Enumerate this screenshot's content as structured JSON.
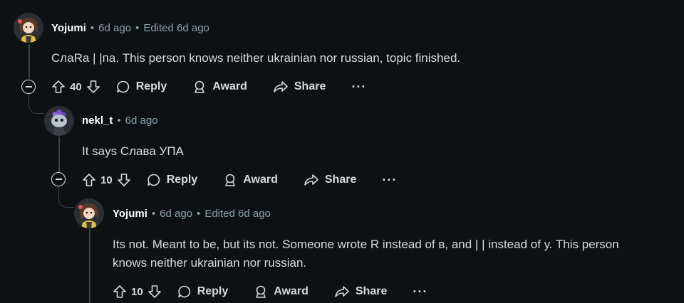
{
  "comments": [
    {
      "username": "Yojumi",
      "time": "6d ago",
      "edited": "Edited 6d ago",
      "body": "СлаRa | |па. This person knows neither ukrainian nor russian, topic finished.",
      "votes": "40",
      "avatar": "yojumi-avatar"
    },
    {
      "username": "nekl_t",
      "time": "6d ago",
      "body": "It says Слава УПА",
      "votes": "10",
      "avatar": "nekl-avatar"
    },
    {
      "username": "Yojumi",
      "time": "6d ago",
      "edited": "Edited 6d ago",
      "body_line1": "Its not. Meant to be, but its not. Someone wrote R instead of в, and | | instead of у. This person",
      "body_line2": "knows neither ukrainian nor russian.",
      "votes": "10",
      "avatar": "yojumi-avatar"
    }
  ],
  "actions": {
    "reply": "Reply",
    "award": "Award",
    "share": "Share",
    "more": "···",
    "separator": "•"
  }
}
